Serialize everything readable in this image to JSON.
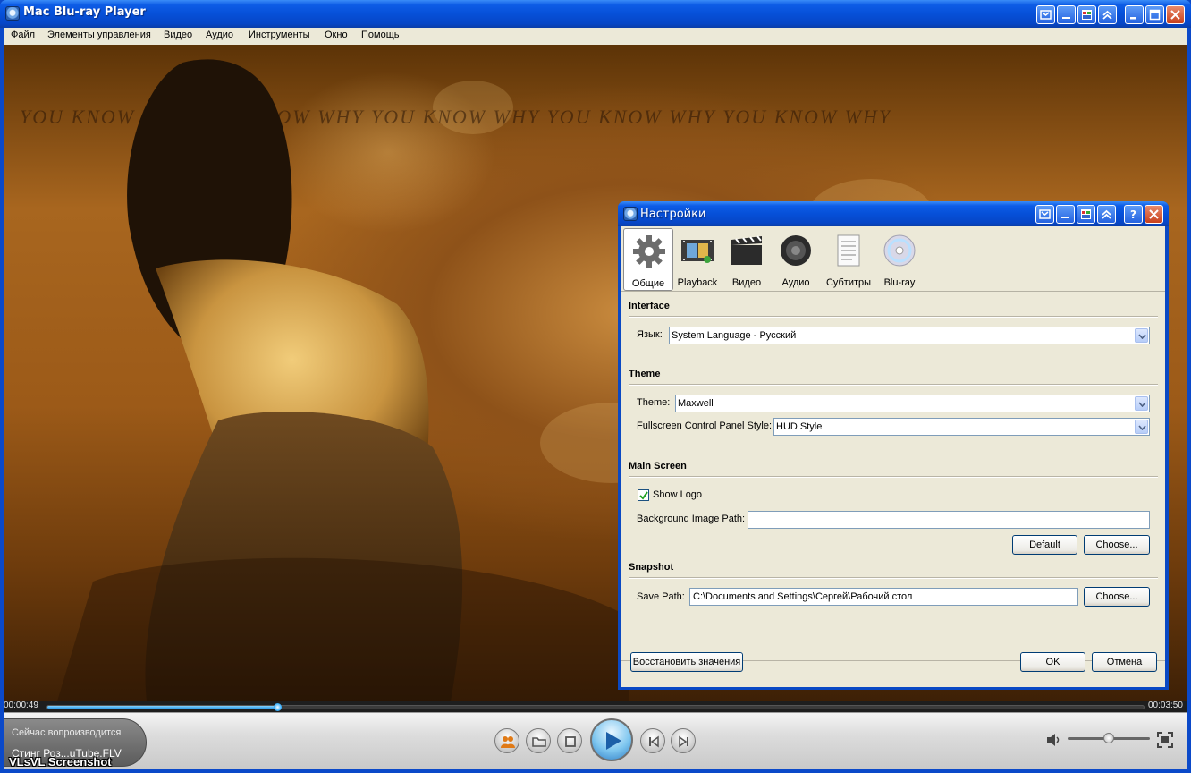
{
  "app": {
    "title": "Mac Blu-ray Player",
    "menu": [
      "Файл",
      "Элементы управления",
      "Видео",
      "Аудио",
      "Инструменты",
      "Окно",
      "Помощь"
    ]
  },
  "video": {
    "caption": "YOU KNOW WHY  YOU KNOW WHY  YOU KNOW WHY  YOU KNOW WHY  YOU KNOW WHY"
  },
  "player": {
    "elapsed": "00:00:49",
    "total": "00:03:50",
    "progress_fraction": 0.21,
    "volume_fraction": 0.5,
    "now_playing_label": "Сейчас вопроизводится",
    "track": "Стинг Роз...uTube.FLV",
    "watermark": "VLsVL Screenshot"
  },
  "settings": {
    "title": "Настройки",
    "tabs": [
      {
        "label": "Общие",
        "icon": "gear-icon",
        "active": true
      },
      {
        "label": "Playback",
        "icon": "film-strip-icon",
        "active": false
      },
      {
        "label": "Видео",
        "icon": "clapperboard-icon",
        "active": false
      },
      {
        "label": "Аудио",
        "icon": "speaker-icon",
        "active": false
      },
      {
        "label": "Субтитры",
        "icon": "document-icon",
        "active": false
      },
      {
        "label": "Blu-ray",
        "icon": "disc-icon",
        "active": false
      }
    ],
    "interface": {
      "heading": "Interface",
      "language_label": "Язык:",
      "language_value": "System Language - Русский"
    },
    "theme": {
      "heading": "Theme",
      "theme_label": "Theme:",
      "theme_value": "Maxwell",
      "fs_label": "Fullscreen Control Panel Style:",
      "fs_value": "HUD Style"
    },
    "main_screen": {
      "heading": "Main Screen",
      "show_logo_label": "Show Logo",
      "show_logo_checked": true,
      "bg_label": "Background Image Path:",
      "bg_value": "",
      "default_btn": "Default",
      "choose_btn": "Choose..."
    },
    "snapshot": {
      "heading": "Snapshot",
      "save_label": "Save Path:",
      "save_value": "C:\\Documents and Settings\\Сергей\\Рабочий стол",
      "choose_btn": "Choose..."
    },
    "buttons": {
      "restore": "Восстановить значения",
      "ok": "OK",
      "cancel": "Отмена"
    }
  }
}
